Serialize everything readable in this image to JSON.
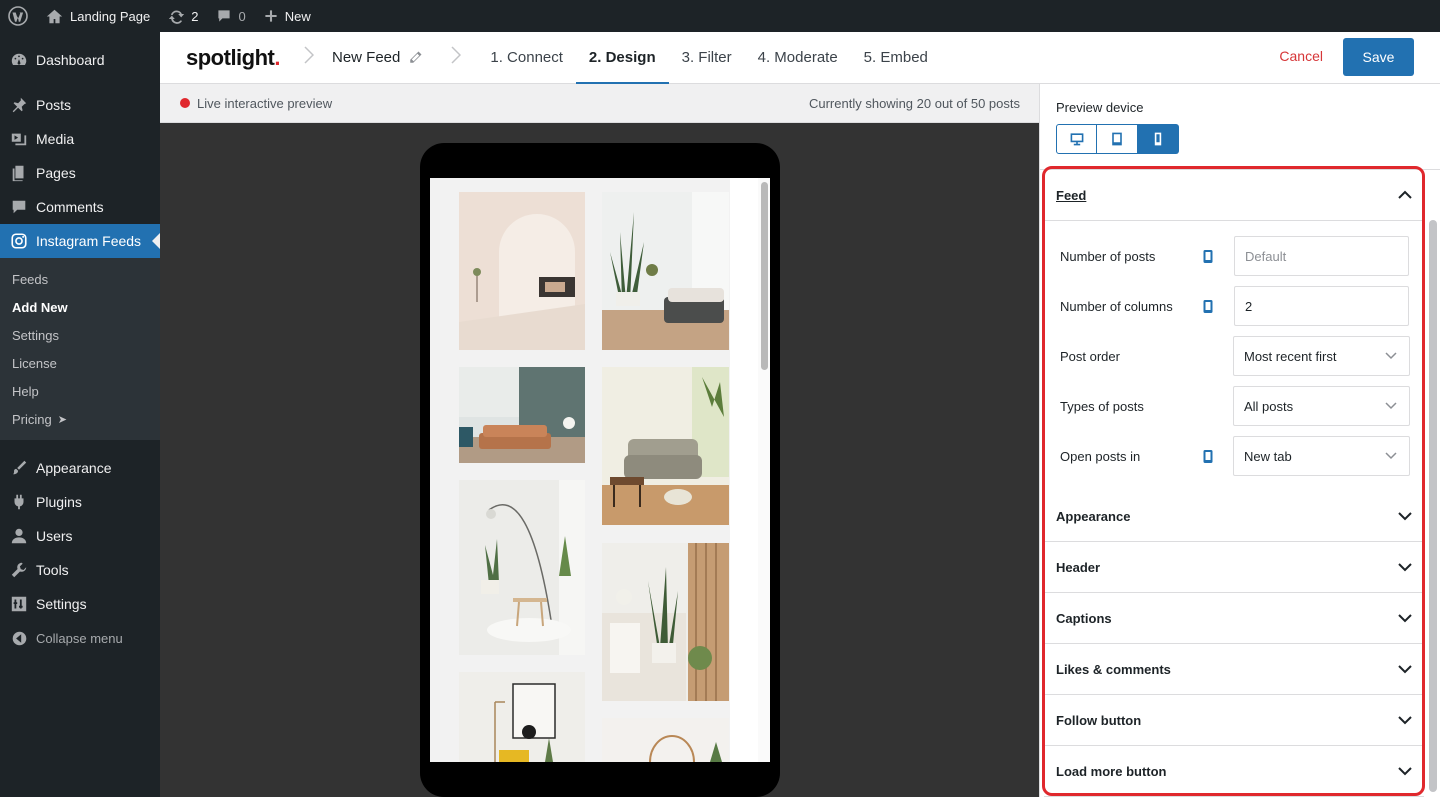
{
  "adminbar": {
    "wp_logo_icon": "wordpress-icon",
    "site_name": "Landing Page",
    "updates_count": "2",
    "comments_count": "0",
    "new_label": "New"
  },
  "sidebar": {
    "dashboard": "Dashboard",
    "posts": "Posts",
    "media": "Media",
    "pages": "Pages",
    "comments": "Comments",
    "instagram_feeds": "Instagram Feeds",
    "sub": {
      "feeds": "Feeds",
      "add_new": "Add New",
      "settings": "Settings",
      "license": "License",
      "help": "Help",
      "pricing": "Pricing",
      "pricing_arrow": "➤"
    },
    "appearance": "Appearance",
    "plugins": "Plugins",
    "users": "Users",
    "tools": "Tools",
    "settings": "Settings",
    "collapse": "Collapse menu"
  },
  "header": {
    "logo_text": "spotlight",
    "logo_dot": ".",
    "feed_name": "New Feed",
    "steps": [
      "1. Connect",
      "2. Design",
      "3. Filter",
      "4. Moderate",
      "5. Embed"
    ],
    "active_step": "2. Design",
    "cancel_label": "Cancel",
    "save_label": "Save"
  },
  "preview": {
    "live_label": "Live interactive preview",
    "showing_text": "Currently showing 20 out of 50 posts"
  },
  "panel": {
    "preview_device_label": "Preview device",
    "devices": [
      "desktop-icon",
      "tablet-icon",
      "phone-icon"
    ],
    "active_device": "phone-icon",
    "feed_section": {
      "title": "Feed",
      "fields": {
        "num_posts": {
          "label": "Number of posts",
          "placeholder": "Default",
          "value": ""
        },
        "num_columns": {
          "label": "Number of columns",
          "value": "2"
        },
        "post_order": {
          "label": "Post order",
          "value": "Most recent first"
        },
        "types_of_posts": {
          "label": "Types of posts",
          "value": "All posts"
        },
        "open_posts_in": {
          "label": "Open posts in",
          "value": "New tab"
        }
      }
    },
    "sections": [
      "Appearance",
      "Header",
      "Captions",
      "Likes & comments",
      "Follow button",
      "Load more button"
    ]
  },
  "colors": {
    "wp_dark": "#1d2327",
    "wp_blue": "#2271b1",
    "accent_red": "#e0282d",
    "stage": "#333333"
  }
}
